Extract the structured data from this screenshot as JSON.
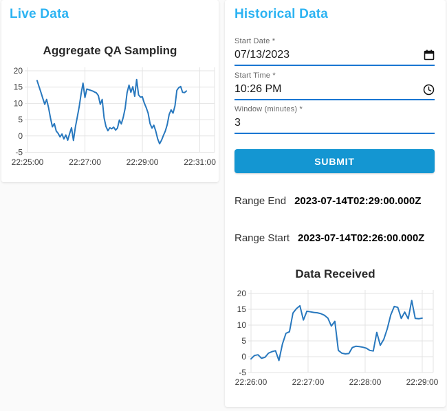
{
  "page": {
    "background": "#fafafa",
    "accent_blue": "#2cb3f2",
    "underline_blue": "#1976d2",
    "submit_blue": "#1496d2",
    "line_blue": "#2878be"
  },
  "live_panel": {
    "title": "Live Data"
  },
  "historical_panel": {
    "title": "Historical Data",
    "fields": [
      {
        "label": "Start Date *",
        "value": "07/13/2023",
        "icon": "calendar-icon"
      },
      {
        "label": "Start Time *",
        "value": "10:26 PM",
        "icon": "clock-icon"
      },
      {
        "label": "Window (minutes) *",
        "value": "3",
        "icon": null
      }
    ],
    "submit_label": "SUBMIT",
    "results": [
      {
        "label": "Range End",
        "value": "2023-07-14T02:29:00.000Z"
      },
      {
        "label": "Range Start",
        "value": "2023-07-14T02:26:00.000Z"
      }
    ]
  },
  "chart_data": [
    {
      "type": "line",
      "title": "Aggregate QA Sampling",
      "x_tick_labels": [
        "22:25:00",
        "22:27:00",
        "22:29:00",
        "22:31:00"
      ],
      "x_tick_seconds": [
        0,
        120,
        240,
        360
      ],
      "y_ticks": [
        -5,
        0,
        5,
        10,
        15,
        20
      ],
      "ylim": [
        -5,
        20
      ],
      "grid": true,
      "line_color": "#2878be",
      "series": [
        {
          "name": "aggregate-qa-sampling",
          "start_second": 20,
          "end_second": 332,
          "values": [
            17.0,
            15.2,
            13.4,
            11.5,
            9.7,
            11.2,
            8.7,
            5.5,
            2.8,
            3.8,
            1.5,
            0.8,
            -0.3,
            0.6,
            -0.9,
            0.3,
            -1.3,
            0.7,
            2.5,
            -1.4,
            2.7,
            5.8,
            9.0,
            13.0,
            16.2,
            11.8,
            14.4,
            14.2,
            14.0,
            13.8,
            13.5,
            13.2,
            12.4,
            9.7,
            11.2,
            5.5,
            2.9,
            1.6,
            2.5,
            2.2,
            2.7,
            1.8,
            2.4,
            4.9,
            3.7,
            5.7,
            8.5,
            13.3,
            15.6,
            13.4,
            15.1,
            12.2,
            17.3,
            12.6,
            11.9,
            12.0,
            10.1,
            8.7,
            7.0,
            3.8,
            2.4,
            3.3,
            1.5,
            -0.9,
            -2.4,
            -1.3,
            0.2,
            1.5,
            3.5,
            6.6,
            8.0,
            7.0,
            9.2,
            14.0,
            14.8,
            15.2,
            13.4,
            13.3,
            13.8
          ]
        }
      ]
    },
    {
      "type": "line",
      "title": "Data Received",
      "x_tick_labels": [
        "22:26:00",
        "22:27:00",
        "22:28:00",
        "22:29:00"
      ],
      "x_tick_seconds": [
        0,
        60,
        120,
        180
      ],
      "y_ticks": [
        -5,
        0,
        5,
        10,
        15,
        20
      ],
      "ylim": [
        -5,
        20
      ],
      "grid": true,
      "line_color": "#2878be",
      "series": [
        {
          "name": "data-received",
          "start_second": 0,
          "end_second": 180,
          "values": [
            -0.7,
            0.4,
            0.6,
            -0.5,
            -0.2,
            1.1,
            1.6,
            1.9,
            -1.2,
            4.0,
            7.4,
            7.9,
            13.8,
            15.2,
            16.1,
            11.6,
            14.4,
            14.2,
            14.0,
            13.9,
            13.6,
            13.1,
            12.2,
            9.7,
            11.2,
            2.0,
            1.1,
            0.9,
            1.0,
            2.9,
            3.3,
            3.2,
            3.0,
            2.7,
            2.0,
            1.8,
            7.7,
            3.6,
            5.5,
            8.8,
            13.2,
            15.9,
            15.6,
            12.1,
            14.1,
            12.0,
            17.8,
            12.1,
            12.0,
            12.2
          ]
        }
      ]
    }
  ]
}
